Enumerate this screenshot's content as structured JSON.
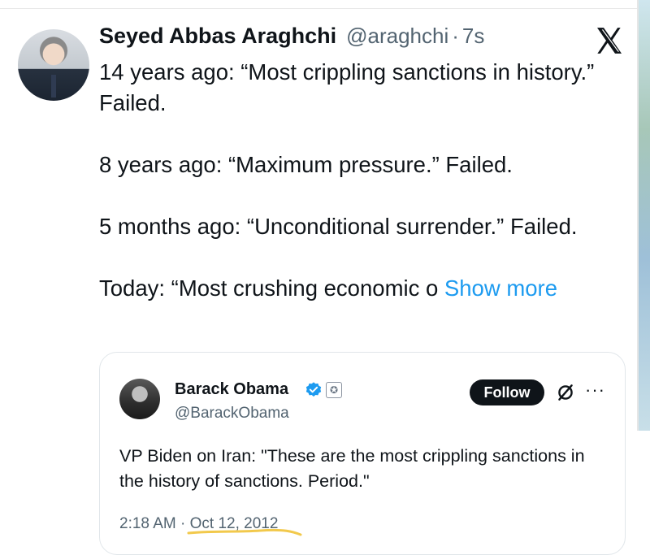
{
  "tweet": {
    "author_name": "Seyed Abbas Araghchi",
    "handle": "@araghchi",
    "separator": "·",
    "time": "7s",
    "lines": [
      "14 years ago: “Most crippling sanctions in history.” Failed.",
      "8 years ago: “Maximum pressure.” Failed.",
      "5 months ago: “Unconditional surrender.” Failed.",
      "Today: “Most crushing economic o"
    ],
    "show_more": "Show more"
  },
  "quoted_tweet": {
    "author_name": "Barack Obama",
    "handle": "@BarackObama",
    "follow_label": "Follow",
    "text": "VP Biden on Iran: \"These are the most crippling sanctions in the history of sanctions. Period.\"",
    "time": "2:18 AM",
    "separator": "·",
    "date": "Oct 12, 2012"
  },
  "colors": {
    "link_blue": "#1d9bf0",
    "text": "#0f1419",
    "muted": "#536471",
    "highlight": "#f2c94c"
  },
  "icons": [
    "x-logo-icon",
    "verified-badge-icon",
    "government-seal-icon",
    "grok-icon",
    "more-options-icon"
  ]
}
